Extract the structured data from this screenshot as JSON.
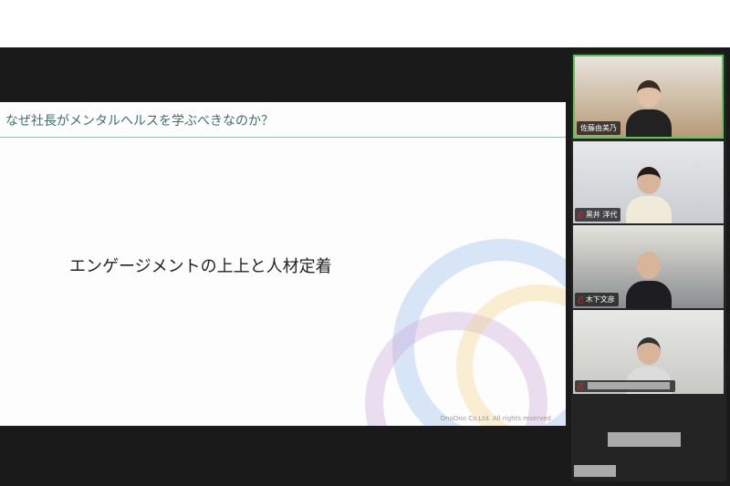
{
  "slide": {
    "title": "なぜ社長がメンタルヘルスを学ぶべきなのか？",
    "main_text": "エンゲージメントの上上と人材定着",
    "copyright": "OnoOno Co.Ltd.  All rights reserved"
  },
  "participants": [
    {
      "name": "佐藤由美乃",
      "active": true,
      "muted": false
    },
    {
      "name": "黒井 洋代",
      "muted": true
    },
    {
      "name": "木下文彦",
      "muted": true
    },
    {
      "name": "",
      "muted": true
    }
  ],
  "icons": {
    "mic_muted": "mic-muted-icon"
  },
  "colors": {
    "active_speaker": "#5ec45e",
    "title": "#3e6e6a"
  }
}
